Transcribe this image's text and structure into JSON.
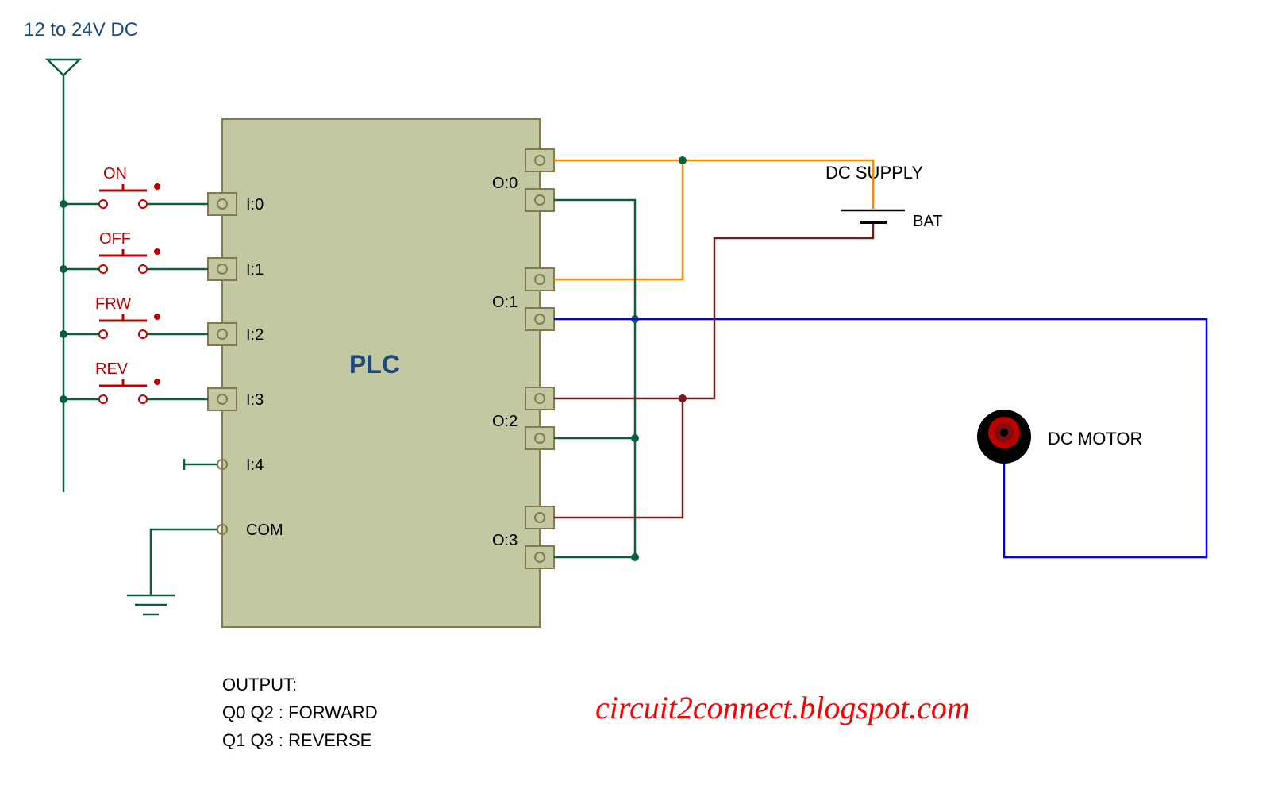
{
  "voltage_label": "12 to 24V DC",
  "plc": {
    "title": "PLC",
    "inputs": {
      "I0": "I:0",
      "I1": "I:1",
      "I2": "I:2",
      "I3": "I:3",
      "I4": "I:4",
      "COM": "COM"
    },
    "outputs": {
      "O0": "O:0",
      "O1": "O:1",
      "O2": "O:2",
      "O3": "O:3"
    }
  },
  "switches": {
    "on": "ON",
    "off": "OFF",
    "frw": "FRW",
    "rev": "REV"
  },
  "dc_supply": {
    "title": "DC SUPPLY",
    "bat": "BAT"
  },
  "motor": {
    "label": "DC MOTOR"
  },
  "output_block": {
    "header": "OUTPUT:",
    "line1": "Q0 Q2 : FORWARD",
    "line2": "Q1 Q3 : REVERSE"
  },
  "watermark": "circuit2connect.blogspot.com",
  "colors": {
    "plc_fill": "#c2c8a2",
    "plc_stroke": "#867a4b",
    "wire_green": "#0b5f3a",
    "wire_orange": "#ff8c00",
    "wire_blue": "#0000ff",
    "wire_darkred": "#7a1b1b",
    "switch_label": "#c00000",
    "heading_blue": "#1f497d",
    "watermark_red": "#ff0000"
  }
}
